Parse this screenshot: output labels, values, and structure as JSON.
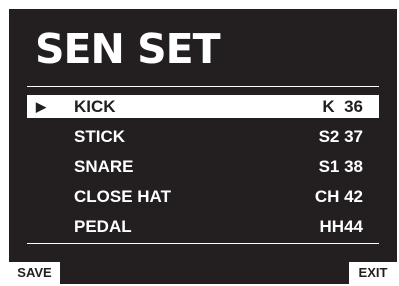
{
  "screen": {
    "title": "SEN SET"
  },
  "menu": {
    "items": [
      {
        "name": "KICK",
        "note": "K  36",
        "selected": true,
        "cursor": "▶"
      },
      {
        "name": "STICK",
        "note": "S2 37",
        "selected": false
      },
      {
        "name": "SNARE",
        "note": "S1 38",
        "selected": false
      },
      {
        "name": "CLOSE HAT",
        "note": "CH 42",
        "selected": false
      },
      {
        "name": "PEDAL",
        "note": "HH44",
        "selected": false
      }
    ]
  },
  "softkeys": {
    "left_label": "SAVE",
    "right_label": "EXIT"
  },
  "colors": {
    "background": "#231f20",
    "foreground": "#ffffff"
  }
}
